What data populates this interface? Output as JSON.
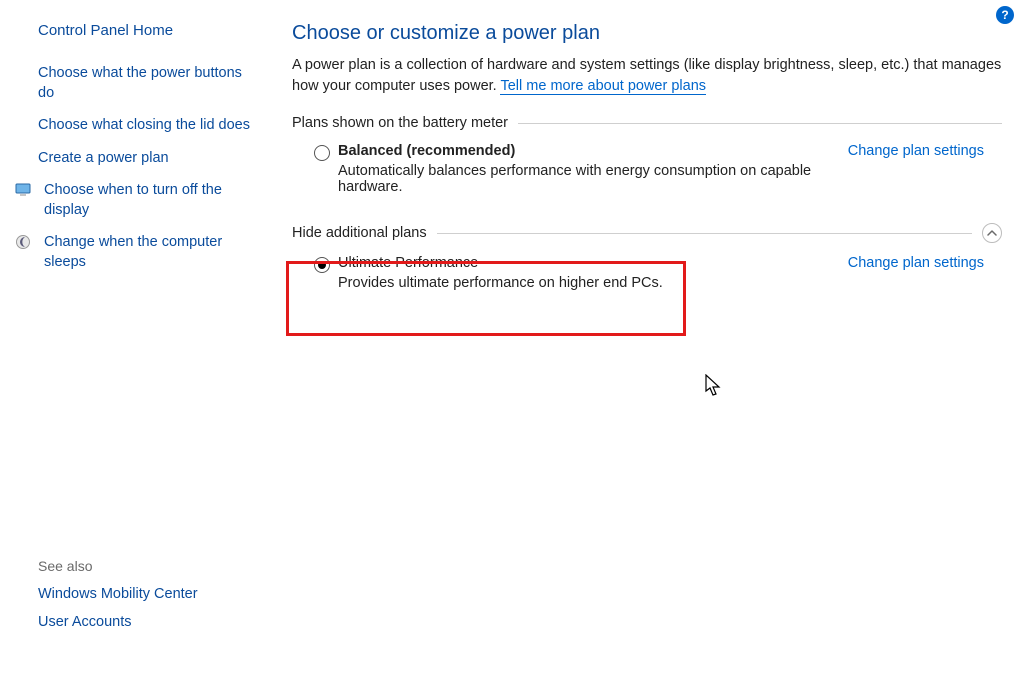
{
  "sidebar": {
    "home": "Control Panel Home",
    "links": [
      {
        "label": "Choose what the power buttons do",
        "icon": null
      },
      {
        "label": "Choose what closing the lid does",
        "icon": null
      },
      {
        "label": "Create a power plan",
        "icon": null
      },
      {
        "label": "Choose when to turn off the display",
        "icon": "monitor"
      },
      {
        "label": "Change when the computer sleeps",
        "icon": "moon"
      }
    ],
    "see_also_label": "See also",
    "footer": [
      "Windows Mobility Center",
      "User Accounts"
    ]
  },
  "main": {
    "title": "Choose or customize a power plan",
    "intro_text": "A power plan is a collection of hardware and system settings (like display brightness, sleep, etc.) that manages how your computer uses power. ",
    "intro_link": "Tell me more about power plans",
    "group1_label": "Plans shown on the battery meter",
    "plan1": {
      "name": "Balanced (recommended)",
      "desc": "Automatically balances performance with energy consumption on capable hardware.",
      "change": "Change plan settings",
      "selected": false
    },
    "group2_label": "Hide additional plans",
    "plan2": {
      "name": "Ultimate Performance",
      "desc": "Provides ultimate performance on higher end PCs.",
      "change": "Change plan settings",
      "selected": true
    }
  },
  "help_badge": "?"
}
